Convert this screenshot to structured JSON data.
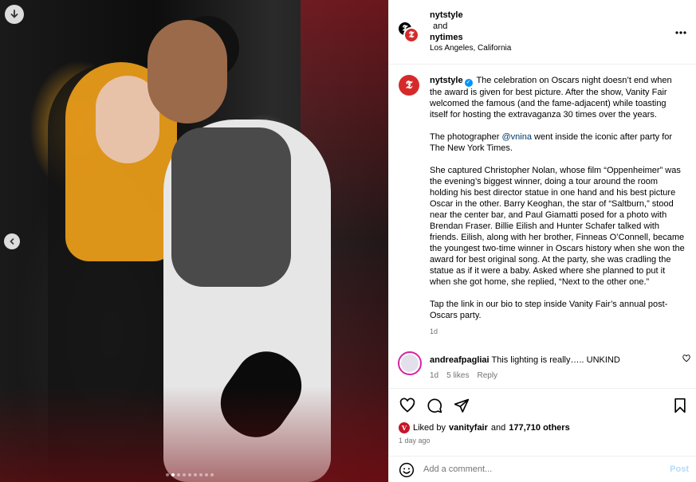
{
  "header": {
    "account_1": "nytstyle",
    "joiner": "and",
    "account_2": "nytimes",
    "location": "Los Angeles, California",
    "avatar_glyph": "𝕿"
  },
  "caption": {
    "username": "nytstyle",
    "avatar_glyph": "𝕿",
    "p1": "The celebration on Oscars night doesn’t end when the award is given for best picture. After the show, Vanity Fair welcomed the famous (and the fame-adjacent) while toasting itself for hosting the extravaganza 30 times over the years.",
    "p2_before": "The photographer ",
    "p2_mention": "@vnina",
    "p2_after": " went inside the iconic after party for The New York Times.",
    "p3": "She captured Christopher Nolan, whose film “Oppenheimer” was the evening’s biggest winner, doing a tour around the room holding his best director statue in one hand and his best picture Oscar in the other. Barry Keoghan, the star of “Saltburn,” stood near the center bar, and Paul Giamatti posed for a photo with Brendan Fraser. Billie Eilish and Hunter Schafer talked with friends. Eilish, along with her brother, Finneas O’Connell, became the youngest two-time winner in Oscars history when she won the award for best original song. At the party, she was cradling the statue as if it were a baby. Asked where she planned to put it when she got home, she replied, “Next to the other one.”",
    "p4": "Tap the link in our bio to step inside Vanity Fair’s annual post-Oscars party.",
    "time": "1d"
  },
  "comment": {
    "username": "andreafpagliai",
    "text": "This lighting is really….. UNKIND",
    "time": "1d",
    "likes": "5 likes",
    "reply": "Reply"
  },
  "actions": {
    "liked_prefix": "Liked by ",
    "liked_user": "vanityfair",
    "liked_mid": " and ",
    "liked_count": "177,710 others",
    "badge": "V",
    "time_ago": "1 day ago"
  },
  "add_comment": {
    "placeholder": "Add a comment...",
    "post_label": "Post"
  },
  "carousel": {
    "dot_count": 9,
    "active_index": 1
  },
  "colors": {
    "link": "#00376b",
    "verified": "#0095f6",
    "post_disabled": "#b3dbff",
    "muted": "#737373"
  }
}
